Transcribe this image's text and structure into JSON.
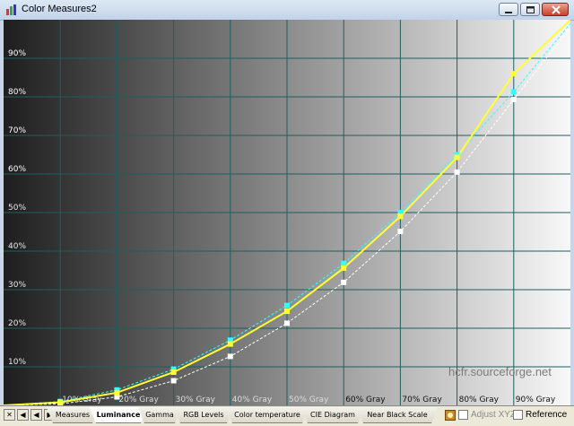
{
  "window": {
    "title": "Color Measures2"
  },
  "watermark": "hcfr.sourceforge.net",
  "tabs": [
    {
      "label": "Measures",
      "active": false
    },
    {
      "label": "Luminance",
      "active": true
    },
    {
      "label": "Gamma",
      "active": false
    },
    {
      "label": "RGB Levels",
      "active": false
    },
    {
      "label": "Color temperature",
      "active": false
    },
    {
      "label": "CIE Diagram",
      "active": false
    },
    {
      "label": "Near Black Scale",
      "active": false
    }
  ],
  "nav_buttons": [
    "✕",
    "◀",
    "◀",
    "▶"
  ],
  "options": {
    "adjust_xyz": "Adjust XYZ",
    "reference": "Reference"
  },
  "colors": {
    "measured": "#ffff33",
    "reference": "#33ffff",
    "target": "#ffffff",
    "grid": "#1f5f5f"
  },
  "chart_data": {
    "type": "line",
    "x_categories": [
      "10% Gray",
      "20% Gray",
      "30% Gray",
      "40% Gray",
      "50% Gray",
      "60% Gray",
      "70% Gray",
      "80% Gray",
      "90% Gray"
    ],
    "y_ticks": [
      "10%",
      "20%",
      "30%",
      "40%",
      "50%",
      "60%",
      "70%",
      "80%",
      "90%"
    ],
    "xlim": [
      0,
      100
    ],
    "ylim": [
      0,
      100
    ],
    "series": [
      {
        "color": "#ffff33",
        "x": [
          0,
          10,
          20,
          30,
          40,
          50,
          60,
          70,
          80,
          90,
          100
        ],
        "y": [
          0,
          0.8,
          3.3,
          8.6,
          15.9,
          24.4,
          35.6,
          49.0,
          64.3,
          86.0,
          100
        ]
      },
      {
        "color": "#33ffff",
        "x": [
          0,
          10,
          20,
          30,
          40,
          50,
          60,
          70,
          80,
          90,
          100
        ],
        "y": [
          0,
          1.0,
          4.0,
          9.4,
          16.9,
          25.9,
          36.8,
          50.0,
          65.0,
          81.3,
          99
        ]
      },
      {
        "color": "#ffffff",
        "x": [
          0,
          10,
          20,
          30,
          40,
          50,
          60,
          70,
          80,
          90,
          100
        ],
        "y": [
          0,
          0.4,
          2.2,
          6.4,
          12.7,
          21.3,
          31.9,
          45.1,
          60.5,
          79.3,
          98
        ]
      }
    ]
  }
}
